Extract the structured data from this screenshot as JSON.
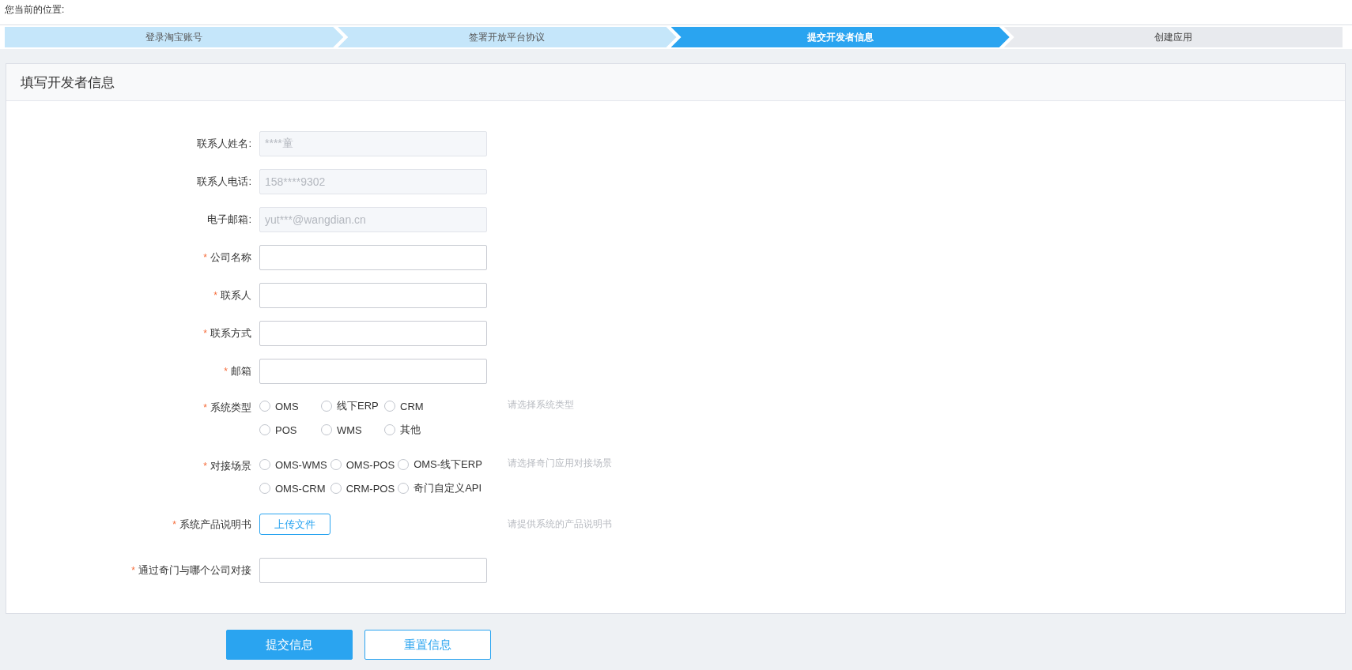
{
  "breadcrumb": {
    "label": "您当前的位置:"
  },
  "steps": [
    {
      "label": "登录淘宝账号",
      "completed": true,
      "selected": false
    },
    {
      "label": "签署开放平台协议",
      "completed": true,
      "selected": false
    },
    {
      "label": "提交开发者信息",
      "completed": false,
      "selected": true
    },
    {
      "label": "创建应用",
      "completed": false,
      "selected": false
    }
  ],
  "panel": {
    "title": "填写开发者信息"
  },
  "fields": [
    {
      "kind": "readonly",
      "label": "联系人姓名:",
      "value": "****童"
    },
    {
      "kind": "readonly",
      "label": "联系人电话:",
      "value": "158****9302"
    },
    {
      "kind": "readonly",
      "label": "电子邮箱:",
      "value": "yut***@wangdian.cn"
    },
    {
      "kind": "text",
      "label": "公司名称",
      "required_mark": "*"
    },
    {
      "kind": "text",
      "label": "联系人",
      "required_mark": "*"
    },
    {
      "kind": "text",
      "label": "联系方式",
      "required_mark": "*"
    },
    {
      "kind": "text",
      "label": "邮箱",
      "required_mark": "*"
    },
    {
      "kind": "radio",
      "label": "系统类型",
      "required_mark": "*",
      "hint": "请选择系统类型",
      "fixed_columns": true,
      "options": [
        {
          "label": "OMS",
          "selected": false
        },
        {
          "label": "线下ERP",
          "selected": false
        },
        {
          "label": "CRM",
          "selected": false
        },
        {
          "label": "POS",
          "selected": false
        },
        {
          "label": "WMS",
          "selected": false
        },
        {
          "label": "其他",
          "selected": false
        }
      ]
    },
    {
      "kind": "radio",
      "label": "对接场景",
      "required_mark": "*",
      "hint": "请选择奇门应用对接场景",
      "fixed_columns": false,
      "options": [
        {
          "label": "OMS-WMS",
          "selected": false
        },
        {
          "label": "OMS-POS",
          "selected": false
        },
        {
          "label": "OMS-线下ERP",
          "selected": false
        },
        {
          "label": "OMS-CRM",
          "selected": false
        },
        {
          "label": "CRM-POS",
          "selected": false
        },
        {
          "label": "奇门自定义API",
          "selected": false
        }
      ]
    },
    {
      "kind": "upload",
      "label": "系统产品说明书",
      "required_mark": "*",
      "button": "上传文件",
      "hint": "请提供系统的产品说明书"
    },
    {
      "kind": "text",
      "label": "通过奇门与哪个公司对接",
      "required_mark": "*"
    }
  ],
  "buttons": [
    {
      "label": "提交信息",
      "kind": "primary"
    },
    {
      "label": "重置信息",
      "kind": "secondary"
    }
  ]
}
